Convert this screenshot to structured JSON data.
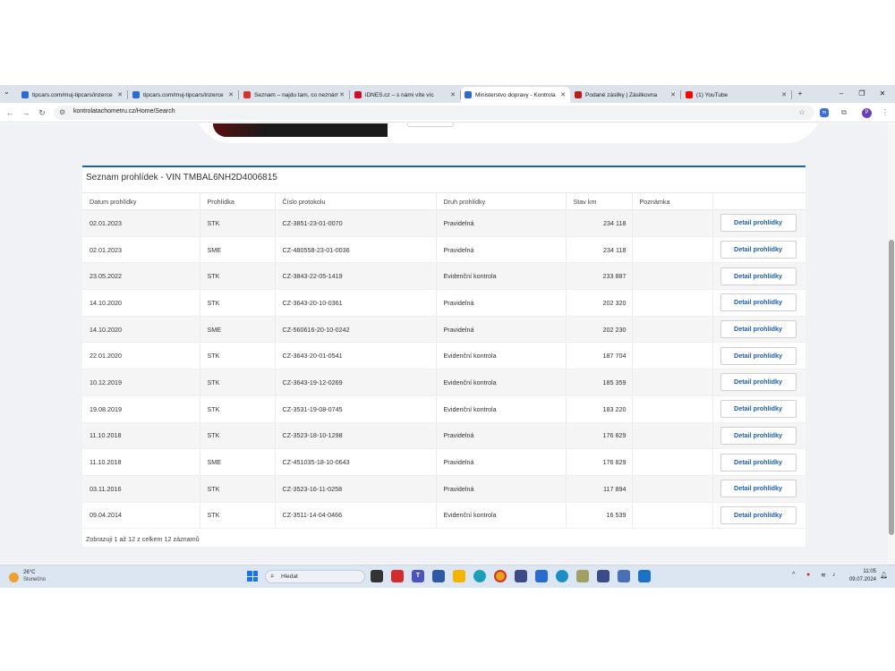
{
  "browser": {
    "tabs": [
      {
        "title": "tipcars.com/muj-tipcars/inzerce",
        "favicon": "tipcars-icon",
        "color": "#2a6bd1",
        "active": false
      },
      {
        "title": "tipcars.com/muj-tipcars/inzerce",
        "favicon": "tipcars-icon",
        "color": "#2a6bd1",
        "active": false
      },
      {
        "title": "Seznam – najdu tam, co neznám",
        "favicon": "seznam-icon",
        "color": "#d6312b",
        "active": false
      },
      {
        "title": "iDNES.cz – s námi víte víc",
        "favicon": "idnes-icon",
        "color": "#c8102e",
        "active": false
      },
      {
        "title": "Ministerstvo dopravy - Kontrola",
        "favicon": "ministry-icon",
        "color": "#2a6bd1",
        "active": true
      },
      {
        "title": "Podané zásilky | Zásilkovna",
        "favicon": "zasilkovna-icon",
        "color": "#ba1b1b",
        "active": false
      },
      {
        "title": "(1) YouTube",
        "favicon": "youtube-icon",
        "color": "#ff0000",
        "active": false
      }
    ],
    "url": "kontrolatachometru.cz/Home/Search",
    "profile_initial": "P"
  },
  "page": {
    "panel_title": "Seznam prohlídek - VIN TMBAL6NH2D4006815",
    "columns": [
      "Datum prohlídky",
      "Prohlídka",
      "Číslo protokolu",
      "Druh prohlídky",
      "Stav km",
      "Poznámka",
      ""
    ],
    "detail_label": "Detail prohlídky",
    "rows": [
      {
        "date": "02.01.2023",
        "type": "STK",
        "protocol": "CZ-3851-23-01-0070",
        "kind": "Pravidelná",
        "km": "234 118",
        "note": ""
      },
      {
        "date": "02.01.2023",
        "type": "SME",
        "protocol": "CZ-480558-23-01-0036",
        "kind": "Pravidelná",
        "km": "234 118",
        "note": ""
      },
      {
        "date": "23.05.2022",
        "type": "STK",
        "protocol": "CZ-3843-22-05-1419",
        "kind": "Evidenční kontrola",
        "km": "233 887",
        "note": ""
      },
      {
        "date": "14.10.2020",
        "type": "STK",
        "protocol": "CZ-3643-20-10-0361",
        "kind": "Pravidelná",
        "km": "202 320",
        "note": ""
      },
      {
        "date": "14.10.2020",
        "type": "SME",
        "protocol": "CZ-560616-20-10-0242",
        "kind": "Pravidelná",
        "km": "202 230",
        "note": ""
      },
      {
        "date": "22.01.2020",
        "type": "STK",
        "protocol": "CZ-3643-20-01-0541",
        "kind": "Evidenční kontrola",
        "km": "187 704",
        "note": ""
      },
      {
        "date": "10.12.2019",
        "type": "STK",
        "protocol": "CZ-3643-19-12-0269",
        "kind": "Evidenční kontrola",
        "km": "185 359",
        "note": ""
      },
      {
        "date": "19.08.2019",
        "type": "STK",
        "protocol": "CZ-3531-19-08-0745",
        "kind": "Evidenční kontrola",
        "km": "183 220",
        "note": ""
      },
      {
        "date": "11.10.2018",
        "type": "STK",
        "protocol": "CZ-3523-18-10-1298",
        "kind": "Pravidelná",
        "km": "176 829",
        "note": ""
      },
      {
        "date": "11.10.2018",
        "type": "SME",
        "protocol": "CZ-451035-18-10-0643",
        "kind": "Pravidelná",
        "km": "176 829",
        "note": ""
      },
      {
        "date": "03.11.2016",
        "type": "STK",
        "protocol": "CZ-3523-16-11-0258",
        "kind": "Pravidelná",
        "km": "117 894",
        "note": ""
      },
      {
        "date": "09.04.2014",
        "type": "STK",
        "protocol": "CZ-3511-14-04-0466",
        "kind": "Evidenční kontrola",
        "km": "16 539",
        "note": ""
      }
    ],
    "footer": "Zobrazuji 1 až 12 z celkem 12 záznamů",
    "accent_color": "#1f5fa8"
  },
  "taskbar": {
    "weather_temp": "26°C",
    "weather_desc": "Slunečno",
    "search_placeholder": "Hledat",
    "time": "11:05",
    "date": "09.07.2024",
    "apps": [
      "file-explorer-icon",
      "anydesk-icon",
      "teams-icon",
      "store-icon",
      "folder-icon",
      "edge-icon",
      "chrome-icon",
      "app-icon",
      "app-icon",
      "app-icon",
      "app-icon",
      "app-icon",
      "app-icon",
      "app-icon"
    ]
  }
}
